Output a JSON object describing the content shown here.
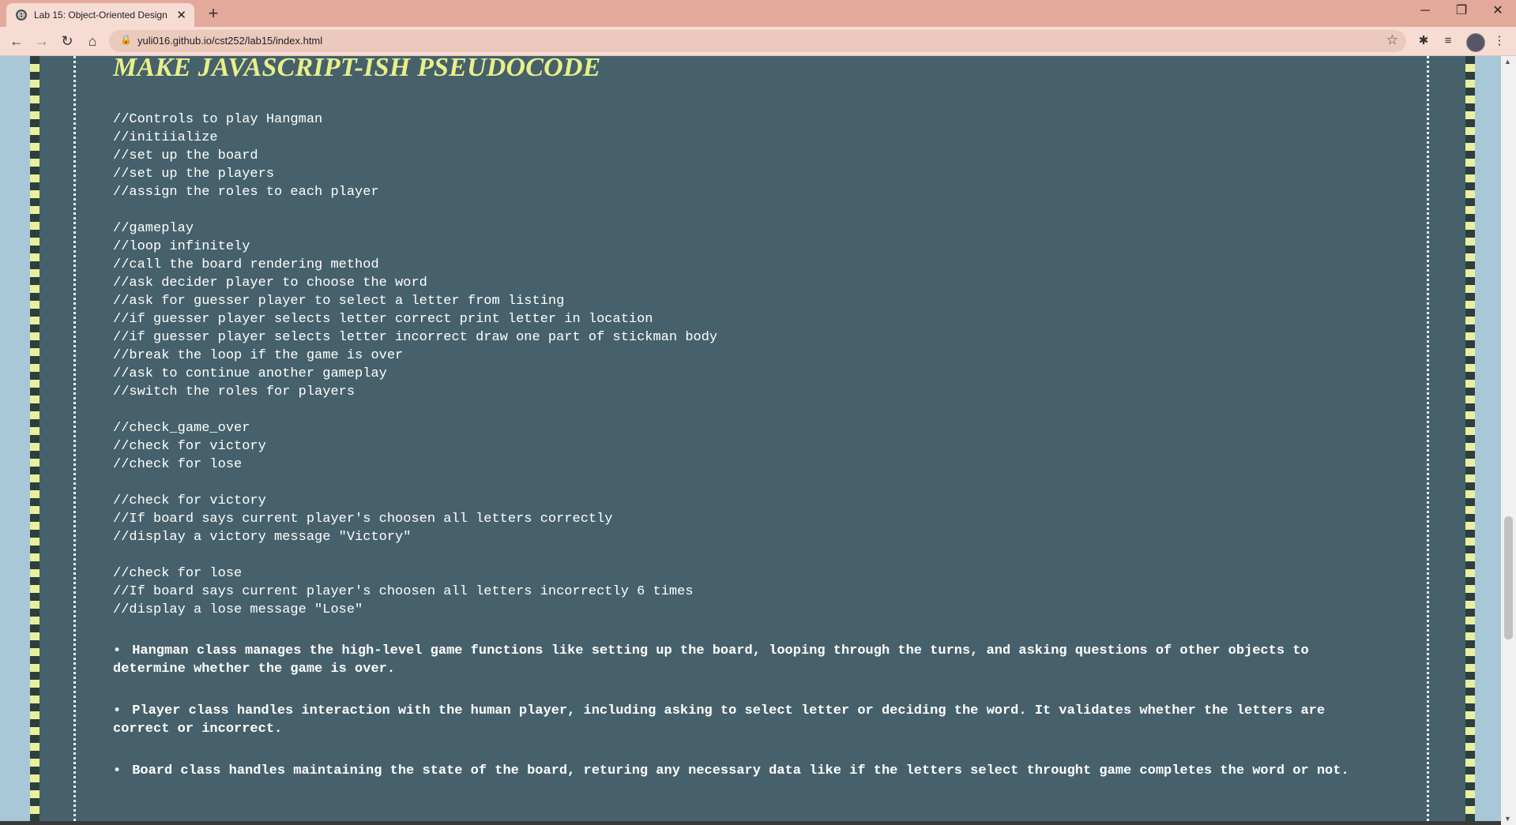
{
  "browser": {
    "tab_title": "Lab 15: Object-Oriented Design",
    "tab_close": "✕",
    "new_tab": "+",
    "url": "yuli016.github.io/cst252/lab15/index.html",
    "window_controls": {
      "minimize": "─",
      "restore": "❐",
      "close": "✕"
    },
    "nav": {
      "back": "←",
      "forward": "→",
      "reload": "↻",
      "home": "⌂"
    }
  },
  "page": {
    "heading": "MAKE JAVASCRIPT-ISH PSEUDOCODE",
    "code_lines": [
      "//Controls to play Hangman",
      "//initiialize",
      "//set up the board",
      "//set up the players",
      "//assign the roles to each player",
      "",
      "//gameplay",
      "//loop infinitely",
      "//call the board rendering method",
      "//ask decider player to choose the word",
      "//ask for guesser player to select a letter from listing",
      "//if guesser player selects letter correct print letter in location",
      "//if guesser player selects letter incorrect draw one part of stickman body",
      "//break the loop if the game is over",
      "//ask to continue another gameplay",
      "//switch the roles for players",
      "",
      "//check_game_over",
      "//check for victory",
      "//check for lose",
      "",
      "//check for victory",
      "//If board says current player's choosen all letters correctly",
      "//display a victory message \"Victory\"",
      "",
      "//check for lose",
      "//If board says current player's choosen all letters incorrectly 6 times",
      "//display a lose message \"Lose\""
    ],
    "bullets": [
      "Hangman class manages the high-level game functions like setting up the board, looping through the turns, and asking questions of other objects to determine whether the game is over.",
      "Player class handles interaction with the human player, including asking to select letter or deciding the word. It validates whether the letters are correct or incorrect.",
      "Board class handles maintaining the state of the board, returing any necessary data like if the letters select throught game completes the word or not."
    ],
    "bullet_symbol": "•"
  },
  "colors": {
    "content_bg": "#46616b",
    "heading": "#e8f08a",
    "page_bg": "#a8c8d8",
    "tab_strip": "#e3a99a"
  }
}
